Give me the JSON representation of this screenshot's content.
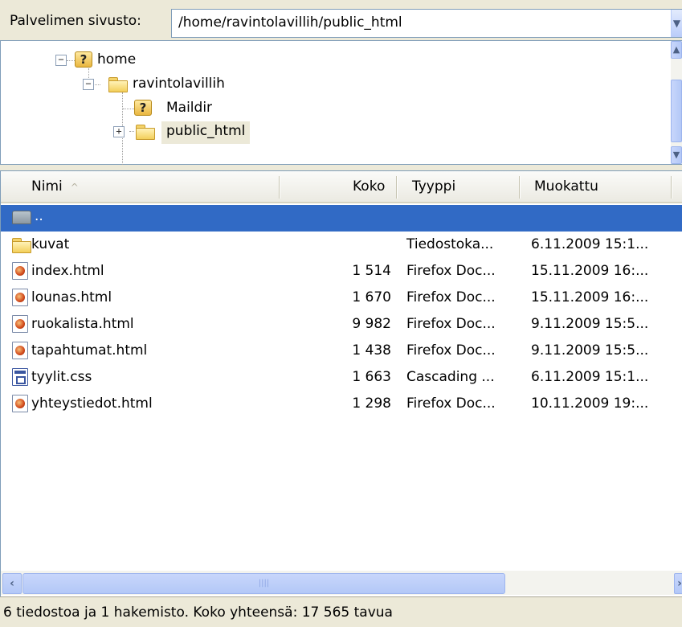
{
  "path_bar": {
    "label": "Palvelimen sivusto:",
    "value": "/home/ravintolavillih/public_html"
  },
  "tree": {
    "nodes": [
      {
        "label": "home",
        "icon": "unknown-folder-icon",
        "expander": "−"
      },
      {
        "label": "ravintolavillih",
        "icon": "folder-icon",
        "expander": "−"
      },
      {
        "label": "Maildir",
        "icon": "unknown-folder-icon"
      },
      {
        "label": "public_html",
        "icon": "folder-icon",
        "expander": "+"
      }
    ]
  },
  "file_list": {
    "columns": [
      "Nimi",
      "Koko",
      "Tyyppi",
      "Muokattu"
    ],
    "sort_indicator": "^",
    "rows": [
      {
        "name": "..",
        "size": "",
        "type": "",
        "modified": "",
        "icon": "parent-folder-icon",
        "selected": true
      },
      {
        "name": "kuvat",
        "size": "",
        "type": "Tiedostoka...",
        "modified": "6.11.2009 15:1...",
        "icon": "folder-icon"
      },
      {
        "name": "index.html",
        "size": "1 514",
        "type": "Firefox Doc...",
        "modified": "15.11.2009 16:...",
        "icon": "html-file-icon"
      },
      {
        "name": "lounas.html",
        "size": "1 670",
        "type": "Firefox Doc...",
        "modified": "15.11.2009 16:...",
        "icon": "html-file-icon"
      },
      {
        "name": "ruokalista.html",
        "size": "9 982",
        "type": "Firefox Doc...",
        "modified": "9.11.2009 15:5...",
        "icon": "html-file-icon"
      },
      {
        "name": "tapahtumat.html",
        "size": "1 438",
        "type": "Firefox Doc...",
        "modified": "9.11.2009 15:5...",
        "icon": "html-file-icon"
      },
      {
        "name": "tyylit.css",
        "size": "1 663",
        "type": "Cascading ...",
        "modified": "6.11.2009 15:1...",
        "icon": "css-file-icon"
      },
      {
        "name": "yhteystiedot.html",
        "size": "1 298",
        "type": "Firefox Doc...",
        "modified": "10.11.2009 19:...",
        "icon": "html-file-icon"
      }
    ]
  },
  "status": {
    "text": "6 tiedostoa ja 1 hakemisto. Koko yhteensä: 17 565 tavua"
  },
  "colors": {
    "selection": "#316ac5",
    "window_bg": "#ece9d8",
    "border": "#7f9db9"
  }
}
